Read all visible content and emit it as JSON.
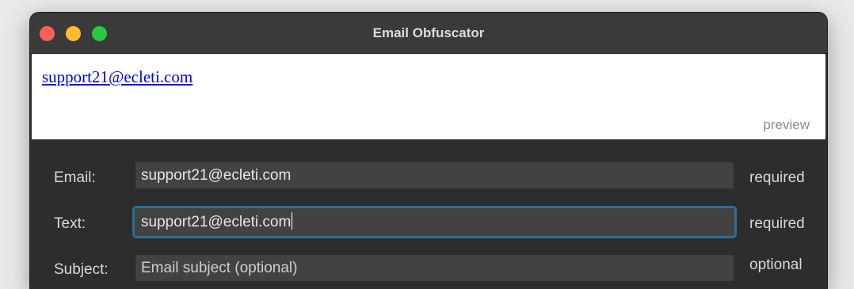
{
  "window": {
    "title": "Email Obfuscator",
    "controls": [
      "close",
      "minimize",
      "zoom"
    ]
  },
  "preview": {
    "link_text": "support21@ecleti.com",
    "label": "preview"
  },
  "form": {
    "email": {
      "label": "Email:",
      "value": "support21@ecleti.com",
      "status": "required"
    },
    "text": {
      "label": "Text:",
      "value": "support21@ecleti.com",
      "status": "required"
    },
    "subject": {
      "label": "Subject:",
      "placeholder": "Email subject (optional)",
      "status": "optional"
    }
  },
  "colors": {
    "close": "#fe5f57",
    "minimize": "#febc2e",
    "zoom": "#28c840",
    "focus_ring": "#2b6f9b",
    "link": "#0000ee"
  }
}
